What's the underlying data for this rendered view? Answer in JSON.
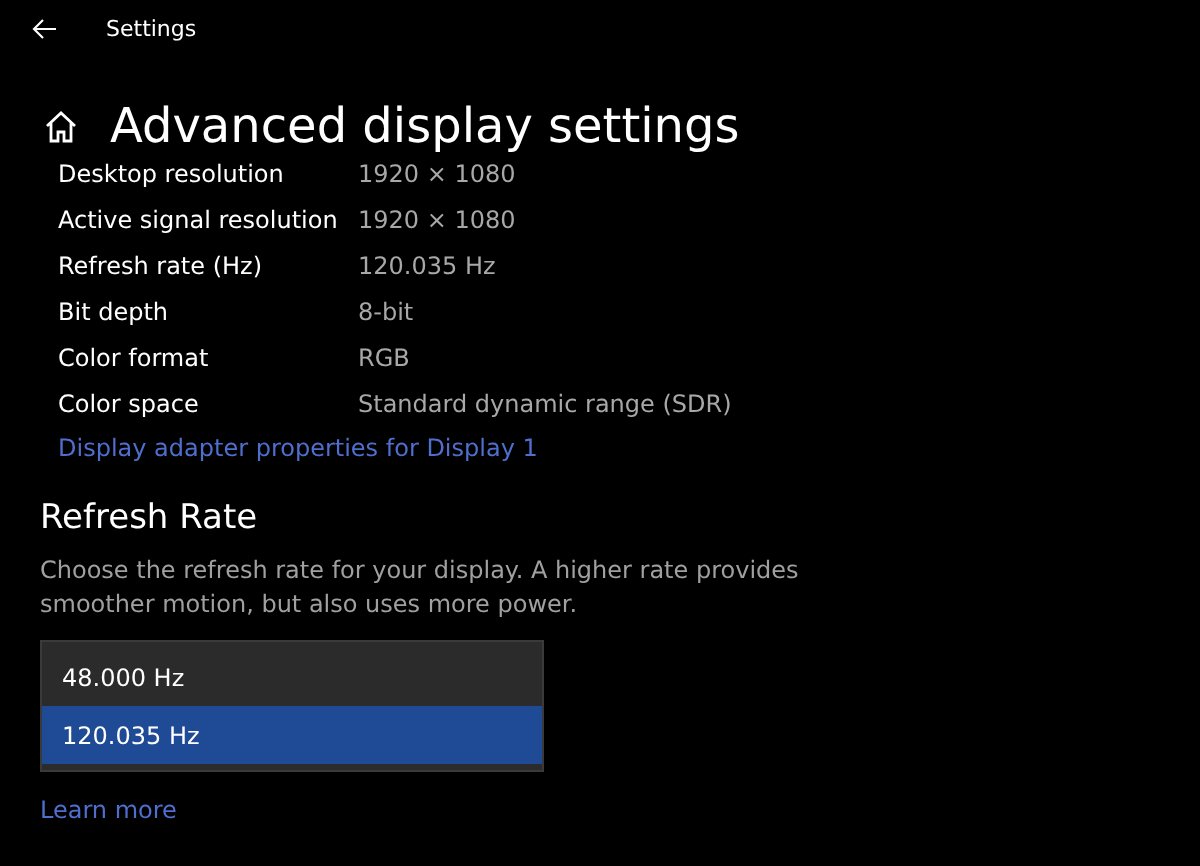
{
  "window": {
    "title": "Settings"
  },
  "page": {
    "title": "Advanced display settings"
  },
  "info_rows": [
    {
      "label": "Desktop resolution",
      "value": "1920 × 1080"
    },
    {
      "label": "Active signal resolution",
      "value": "1920 × 1080"
    },
    {
      "label": "Refresh rate (Hz)",
      "value": "120.035 Hz"
    },
    {
      "label": "Bit depth",
      "value": "8-bit"
    },
    {
      "label": "Color format",
      "value": "RGB"
    },
    {
      "label": "Color space",
      "value": "Standard dynamic range (SDR)"
    }
  ],
  "adapter_link": "Display adapter properties for Display 1",
  "refresh_section": {
    "heading": "Refresh Rate",
    "description": "Choose the refresh rate for your display. A higher rate provides smoother motion, but also uses more power.",
    "options": [
      {
        "label": "48.000 Hz",
        "selected": false
      },
      {
        "label": "120.035 Hz",
        "selected": true
      }
    ],
    "link": "Learn more"
  }
}
